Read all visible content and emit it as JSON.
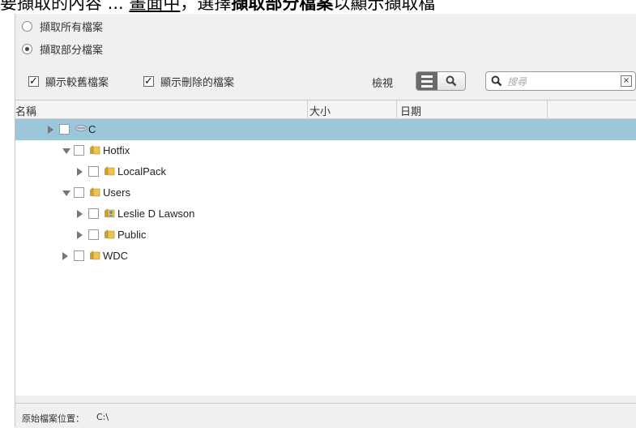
{
  "caption": {
    "part1": "要擷取的內容 ... ",
    "part2": "畫面中",
    "part3": "，選擇",
    "part4": "擷取部分檔案",
    "part5": "以顯示擷取檔"
  },
  "options": {
    "all_files": "擷取所有檔案",
    "some_files": "擷取部分檔案",
    "selected": "some_files"
  },
  "toolbar": {
    "show_old": "顯示較舊檔案",
    "show_deleted": "顯示刪除的檔案",
    "view_label": "檢視",
    "search_placeholder": "搜尋"
  },
  "columns": {
    "name": "名稱",
    "size": "大小",
    "date": "日期"
  },
  "tree": [
    {
      "label": "C",
      "depth": 0,
      "expanded": false,
      "icon": "drive-icon",
      "selected": true
    },
    {
      "label": "Hotfix",
      "depth": 1,
      "expanded": true,
      "icon": "folder-icon"
    },
    {
      "label": "LocalPack",
      "depth": 2,
      "expanded": false,
      "icon": "folder-icon"
    },
    {
      "label": "Users",
      "depth": 1,
      "expanded": true,
      "icon": "folder-icon"
    },
    {
      "label": "Leslie D Lawson",
      "depth": 2,
      "expanded": false,
      "icon": "user-folder-icon"
    },
    {
      "label": "Public",
      "depth": 2,
      "expanded": false,
      "icon": "folder-icon"
    },
    {
      "label": "WDC",
      "depth": 1,
      "expanded": false,
      "icon": "folder-icon"
    }
  ],
  "status": {
    "label": "原始檔案位置：",
    "value": "C:\\"
  }
}
